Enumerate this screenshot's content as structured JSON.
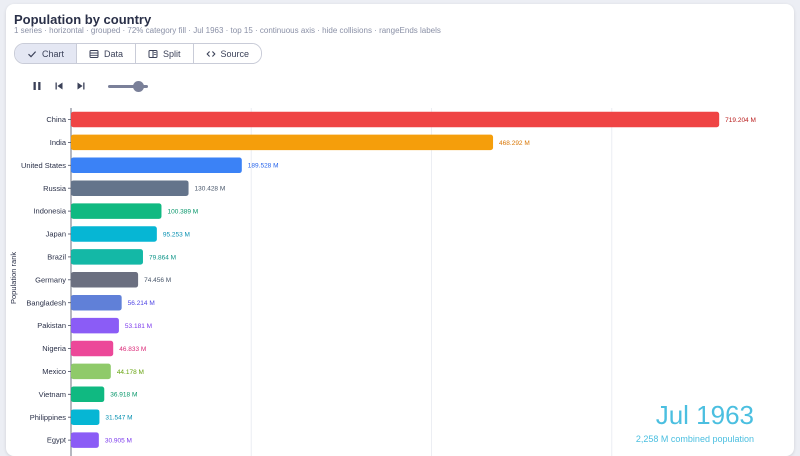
{
  "header": {
    "title": "Population by country",
    "subtitle": "1 series · horizontal · grouped · 72% category fill · Jul 1963 · top 15 · continuous axis · hide collisions · rangeEnds labels"
  },
  "tabs": [
    {
      "label": "Chart",
      "icon": "check-icon",
      "active": true
    },
    {
      "label": "Data",
      "icon": "table-icon",
      "active": false
    },
    {
      "label": "Split",
      "icon": "split-icon",
      "active": false
    },
    {
      "label": "Source",
      "icon": "code-icon",
      "active": false
    }
  ],
  "playback": {
    "state": "playing",
    "progress": 0.75
  },
  "overlay": {
    "date": "Jul 1963",
    "total": "2,258 M combined population"
  },
  "chart_data": {
    "type": "bar",
    "orientation": "horizontal",
    "ylabel": "Population rank",
    "grid": true,
    "categories": [
      "China",
      "India",
      "United States",
      "Russia",
      "Indonesia",
      "Japan",
      "Brazil",
      "Germany",
      "Bangladesh",
      "Pakistan",
      "Nigeria",
      "Mexico",
      "Vietnam",
      "Philippines",
      "Egypt"
    ],
    "values": [
      719.204,
      468.292,
      189.528,
      130.428,
      100.389,
      95.253,
      79.864,
      74.456,
      56.214,
      53.181,
      46.833,
      44.178,
      36.918,
      31.547,
      30.905
    ],
    "value_labels": [
      "719.204 M",
      "468.292 M",
      "189.528 M",
      "130.428 M",
      "100.389 M",
      "95.253 M",
      "79.864 M",
      "74.456 M",
      "56.214 M",
      "53.181 M",
      "46.833 M",
      "44.178 M",
      "36.918 M",
      "31.547 M",
      "30.905 M"
    ],
    "colors": [
      "#ef4444",
      "#f59e0b",
      "#3b82f6",
      "#64748b",
      "#10b981",
      "#06b6d4",
      "#14b8a6",
      "#6b6f80",
      "#6080d8",
      "#8b5cf6",
      "#ec4899",
      "#8fca6a",
      "#10b981",
      "#06b6d4",
      "#8b5cf6"
    ],
    "label_colors": [
      "#b91c1c",
      "#d97706",
      "#2563eb",
      "#475569",
      "#059669",
      "#0891b2",
      "#0d9488",
      "#475569",
      "#4f46e5",
      "#7c3aed",
      "#db2777",
      "#65a30d",
      "#059669",
      "#0891b2",
      "#7c3aed"
    ],
    "xlim": [
      0,
      800
    ]
  }
}
